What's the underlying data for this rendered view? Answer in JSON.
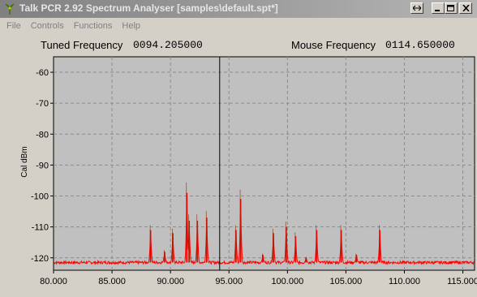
{
  "window": {
    "title": "Talk PCR 2.92 Spectrum Analyser [samples\\default.spt*]",
    "app_icon": "antenna-icon",
    "controls": [
      "resize-icon",
      "minimize-icon",
      "maximize-icon",
      "close-icon"
    ]
  },
  "menu": {
    "items": [
      "File",
      "Controls",
      "Functions",
      "Help"
    ]
  },
  "readouts": {
    "tuned_label": "Tuned Frequency",
    "tuned_value": "0094.205000",
    "mouse_label": "Mouse Frequency",
    "mouse_value": "0114.650000"
  },
  "colors": {
    "plot_bg": "#c0c0c0",
    "trace": "#ff0000",
    "trace_dark": "#7a2a00",
    "grid": "#8c8c8c",
    "cursor": "#000000"
  },
  "chart_data": {
    "type": "line",
    "xlabel": "",
    "ylabel": "Cal dBm",
    "xlim": [
      80.0,
      116.0
    ],
    "ylim": [
      -124,
      -55
    ],
    "x_ticks": [
      80,
      85,
      90,
      95,
      100,
      105,
      110,
      115
    ],
    "x_tick_labels": [
      "80.000",
      "85.000",
      "90.000",
      "95.000",
      "100.000",
      "105.000",
      "110.000",
      "115.000"
    ],
    "y_ticks": [
      -60,
      -70,
      -80,
      -90,
      -100,
      -110,
      -120
    ],
    "y_tick_labels": [
      "-60",
      "-70",
      "-80",
      "-90",
      "-100",
      "-110",
      "-120"
    ],
    "grid": true,
    "cursor_x": 94.205,
    "noise_floor": -121.5,
    "peaks": [
      {
        "x": 88.3,
        "y": -111
      },
      {
        "x": 89.5,
        "y": -118
      },
      {
        "x": 90.2,
        "y": -112
      },
      {
        "x": 91.4,
        "y": -99
      },
      {
        "x": 91.6,
        "y": -108
      },
      {
        "x": 92.3,
        "y": -108
      },
      {
        "x": 93.1,
        "y": -107
      },
      {
        "x": 95.6,
        "y": -111
      },
      {
        "x": 96.0,
        "y": -101
      },
      {
        "x": 97.9,
        "y": -119
      },
      {
        "x": 98.8,
        "y": -112
      },
      {
        "x": 99.9,
        "y": -110
      },
      {
        "x": 100.7,
        "y": -113
      },
      {
        "x": 101.6,
        "y": -120
      },
      {
        "x": 102.5,
        "y": -111
      },
      {
        "x": 104.6,
        "y": -111
      },
      {
        "x": 105.9,
        "y": -119
      },
      {
        "x": 107.9,
        "y": -111
      }
    ]
  }
}
